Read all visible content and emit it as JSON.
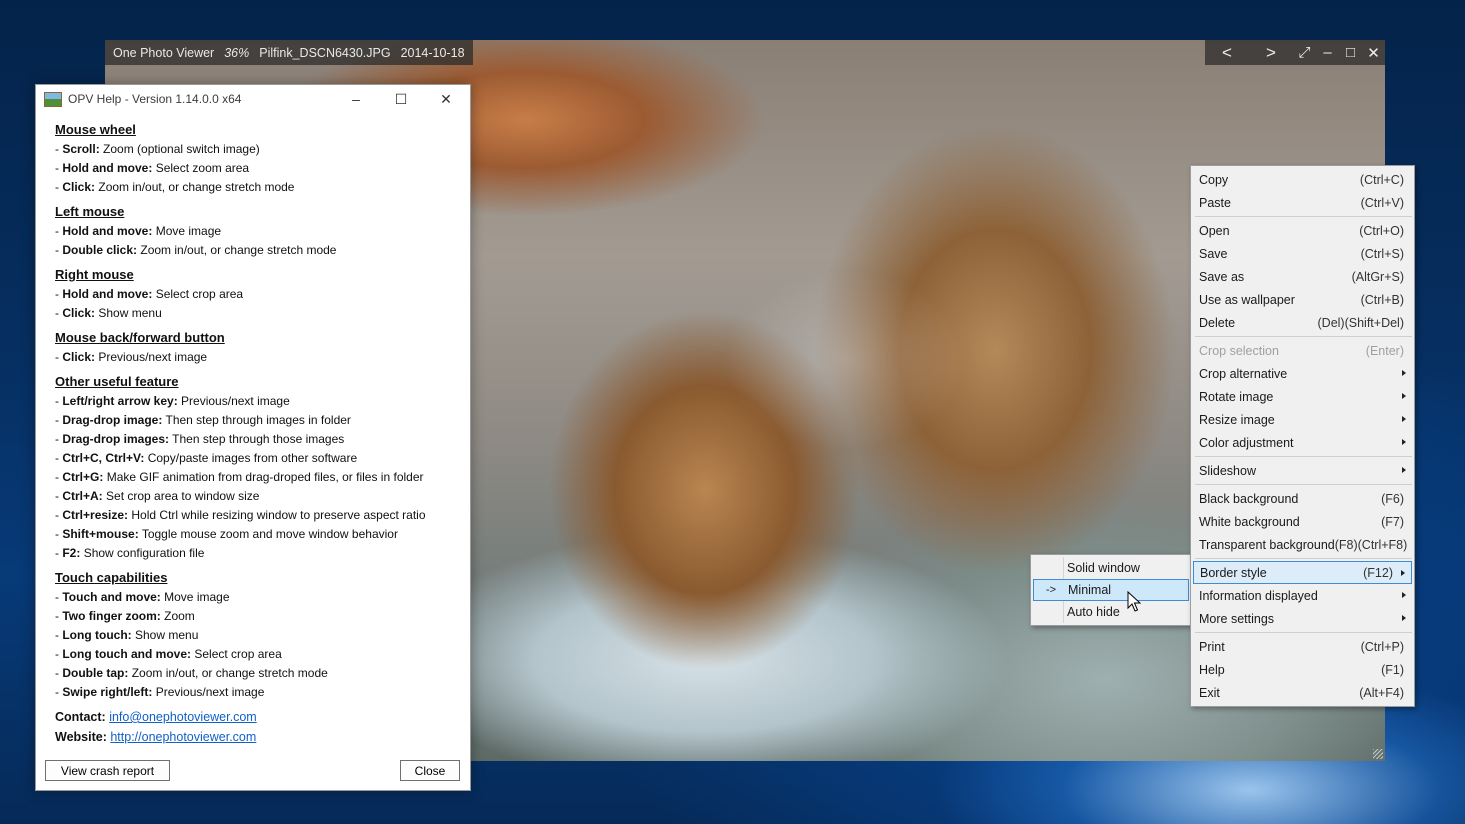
{
  "viewer": {
    "app_name": "One Photo Viewer",
    "zoom": "36%",
    "file_name": "Pilfink_DSCN6430.JPG",
    "date": "2014-10-18",
    "controls": {
      "prev": "<",
      "next": ">",
      "fullscreen": "⤢",
      "minimize": "–",
      "maximize": "□",
      "close": "✕"
    }
  },
  "help": {
    "title": "OPV Help - Version 1.14.0.0 x64",
    "window_controls": {
      "minimize": "–",
      "maximize": "☐",
      "close": "✕"
    },
    "sections": [
      {
        "title": "Mouse wheel",
        "lines": [
          {
            "key": "Scroll:",
            "text": "Zoom (optional switch image)"
          },
          {
            "key": "Hold and move:",
            "text": "Select zoom area"
          },
          {
            "key": "Click:",
            "text": "Zoom in/out, or change stretch mode"
          }
        ]
      },
      {
        "title": "Left mouse",
        "lines": [
          {
            "key": "Hold and move:",
            "text": "Move image"
          },
          {
            "key": "Double click:",
            "text": "Zoom in/out, or change stretch mode"
          }
        ]
      },
      {
        "title": "Right mouse",
        "lines": [
          {
            "key": "Hold and move:",
            "text": "Select crop area"
          },
          {
            "key": "Click:",
            "text": "Show menu"
          }
        ]
      },
      {
        "title": "Mouse back/forward button",
        "lines": [
          {
            "key": "Click:",
            "text": "Previous/next image"
          }
        ]
      },
      {
        "title": "Other useful feature",
        "lines": [
          {
            "key": "Left/right arrow key:",
            "text": "Previous/next image"
          },
          {
            "key": "Drag-drop image:",
            "text": "Then step through images in folder"
          },
          {
            "key": "Drag-drop images:",
            "text": "Then step through those images"
          },
          {
            "key": "Ctrl+C, Ctrl+V:",
            "text": "Copy/paste images from other software"
          },
          {
            "key": "Ctrl+G:",
            "text": "Make GIF animation from drag-droped files, or files in folder"
          },
          {
            "key": "Ctrl+A:",
            "text": "Set crop area to window size"
          },
          {
            "key": "Ctrl+resize:",
            "text": "Hold Ctrl while resizing window to preserve aspect ratio"
          },
          {
            "key": "Shift+mouse:",
            "text": "Toggle mouse zoom and move window behavior"
          },
          {
            "key": "F2:",
            "text": "Show configuration file"
          }
        ]
      },
      {
        "title": "Touch capabilities",
        "lines": [
          {
            "key": "Touch and move:",
            "text": "Move image"
          },
          {
            "key": "Two finger zoom:",
            "text": "Zoom"
          },
          {
            "key": "Long touch:",
            "text": "Show menu"
          },
          {
            "key": "Long touch and move:",
            "text": "Select crop area"
          },
          {
            "key": "Double tap:",
            "text": "Zoom in/out, or change stretch mode"
          },
          {
            "key": "Swipe right/left:",
            "text": "Previous/next image"
          }
        ]
      }
    ],
    "line_prefix": "- ",
    "contact_label": "Contact:",
    "contact_email": "info@onephotoviewer.com",
    "website_label": "Website:",
    "website_url": "http://onephotoviewer.com",
    "crash_report_button": "View crash report",
    "close_button": "Close"
  },
  "menu": {
    "groups": [
      [
        {
          "label": "Copy",
          "shortcut": "(Ctrl+C)"
        },
        {
          "label": "Paste",
          "shortcut": "(Ctrl+V)"
        }
      ],
      [
        {
          "label": "Open",
          "shortcut": "(Ctrl+O)"
        },
        {
          "label": "Save",
          "shortcut": "(Ctrl+S)"
        },
        {
          "label": "Save as",
          "shortcut": "(AltGr+S)"
        },
        {
          "label": "Use as wallpaper",
          "shortcut": "(Ctrl+B)"
        },
        {
          "label": "Delete",
          "shortcut": "(Del)(Shift+Del)"
        }
      ],
      [
        {
          "label": "Crop selection",
          "shortcut": "(Enter)",
          "disabled": true
        },
        {
          "label": "Crop alternative",
          "shortcut": "",
          "submenu": true
        },
        {
          "label": "Rotate image",
          "shortcut": "",
          "submenu": true
        },
        {
          "label": "Resize image",
          "shortcut": "",
          "submenu": true
        },
        {
          "label": "Color adjustment",
          "shortcut": "",
          "submenu": true
        }
      ],
      [
        {
          "label": "Slideshow",
          "shortcut": "",
          "submenu": true
        }
      ],
      [
        {
          "label": "Black background",
          "shortcut": "(F6)"
        },
        {
          "label": "White background",
          "shortcut": "(F7)"
        },
        {
          "label": "Transparent background",
          "shortcut": "(F8)(Ctrl+F8)"
        }
      ],
      [
        {
          "label": "Border style",
          "shortcut": "(F12)",
          "submenu": true,
          "highlight": true
        },
        {
          "label": "Information displayed",
          "shortcut": "",
          "submenu": true
        },
        {
          "label": "More settings",
          "shortcut": "",
          "submenu": true
        }
      ],
      [
        {
          "label": "Print",
          "shortcut": "(Ctrl+P)"
        },
        {
          "label": "Help",
          "shortcut": "(F1)"
        },
        {
          "label": "Exit",
          "shortcut": "(Alt+F4)"
        }
      ]
    ]
  },
  "submenu": {
    "items": [
      {
        "label": "Solid window",
        "mark": ""
      },
      {
        "label": "Minimal",
        "mark": "->",
        "highlight": true
      },
      {
        "label": "Auto hide",
        "mark": ""
      }
    ]
  },
  "colors": {
    "highlight_border": "#3f8cd6",
    "highlight_fill": "#dcecf9",
    "link": "#1060c8",
    "desktop": "#073a78"
  }
}
